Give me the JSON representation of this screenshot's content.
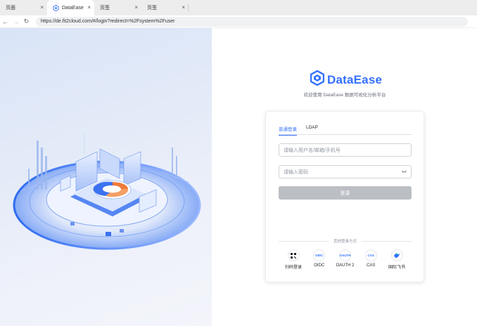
{
  "browser": {
    "tabs": [
      {
        "label": "页面",
        "active": false
      },
      {
        "label": "DataEase",
        "active": true
      },
      {
        "label": "页签",
        "active": false
      },
      {
        "label": "页签",
        "active": false
      }
    ],
    "close_glyph": "×",
    "url": "https://de.fit2cloud.com/#/login?redirect=%2Fsystem%2Fuser"
  },
  "brand": {
    "name": "DataEase",
    "subtitle": "欢迎使用 DataEase 数据可视化分析平台",
    "accent": "#3370ff"
  },
  "login": {
    "tabs": [
      "普通登录",
      "LDAP"
    ],
    "username_placeholder": "请输入用户名/邮箱/手机号",
    "password_placeholder": "请输入密码",
    "submit_label": "登录",
    "other_title": "其他登录方式",
    "methods": [
      {
        "label": "扫码登录",
        "icon": "qrcode-icon"
      },
      {
        "label": "OIDC",
        "icon_text": "OIDC",
        "icon": "oidc-icon"
      },
      {
        "label": "OAUTH 2",
        "icon_text": "OAUTH",
        "icon": "oauth2-icon"
      },
      {
        "label": "CAS",
        "icon_text": "CAS",
        "icon": "cas-icon"
      },
      {
        "label": "国际飞书",
        "icon": "lark-icon"
      }
    ]
  }
}
